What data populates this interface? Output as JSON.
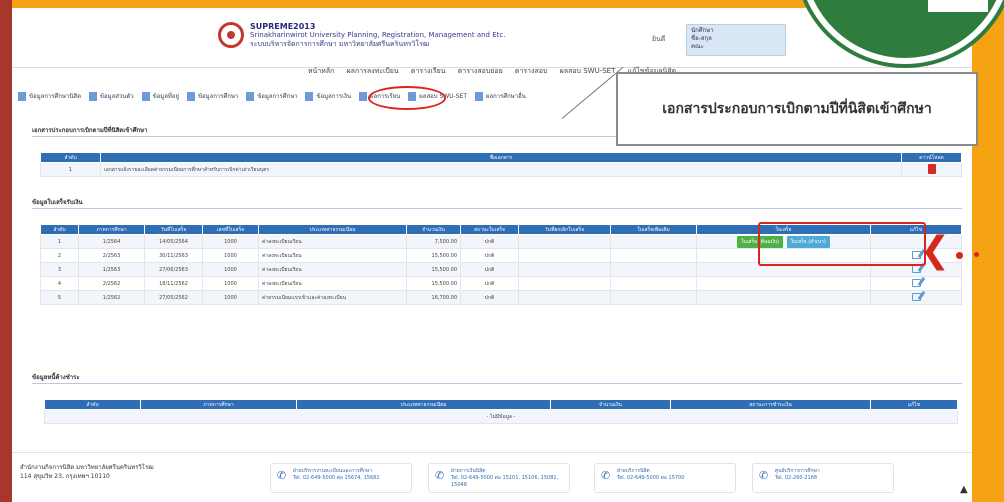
{
  "header": {
    "brand_title": "SUPREME2013",
    "brand_line1": "Srinakharinwirot University Planning, Registration, Management and Etc.",
    "brand_line2": "ระบบบริหารจัดการการศึกษา มหาวิทยาลัยศรีนครินทรวิโรฒ",
    "user_label": "ยินดี",
    "user_lines": [
      "นักศึกษา",
      "ชื่อ-สกุล",
      "คณะ"
    ]
  },
  "menu": [
    "หน้าหลัก",
    "ผลการลงทะเบียน",
    "ตารางเรียน",
    "ตารางสอบย่อย",
    "ตารางสอบ",
    "ผลสอบ SWU-SET",
    "แก้ไขข้อมูลนิสิต"
  ],
  "tabs": [
    "ข้อมูลการศึกษานิสิต",
    "ข้อมูลส่วนตัว",
    "ข้อมูลที่อยู่",
    "ข้อมูลการศึกษา",
    "ข้อมูลการศึกษา",
    "ข้อมูลการเงิน",
    "ผลการเรียน",
    "ผลสอบ SWU-SET",
    "ผลการศึกษาอื่น"
  ],
  "callout": "เอกสารประกอบการเบิกตามปีที่นิสิตเข้าศึกษา",
  "doc_section": {
    "title": "เอกสารประกอบการเบิกตามปีที่นิสิตเข้าศึกษา",
    "columns": [
      "ลำดับ",
      "ชื่อเอกสาร",
      "ดาวน์โหลด"
    ],
    "rows": [
      {
        "no": "1",
        "name": "เอกสารแจ้งรายละเอียดค่าธรรมเนียมการศึกษาสำหรับการเบิกค่าเล่าเรียนบุตร"
      }
    ]
  },
  "payment_section": {
    "title": "ข้อมูลใบเสร็จรับเงิน",
    "columns": [
      "ลำดับ",
      "ภาคการศึกษา",
      "วันที่ใบเสร็จ",
      "เลขที่ใบเสร็จ",
      "ประเภทค่าธรรมเนียม",
      "จำนวนเงิน",
      "สถานะใบเสร็จ",
      "วันที่ยกเลิกใบเสร็จ",
      "ใบเสร็จเพิ่มเติม",
      "ใบเสร็จ",
      "แก้ไข"
    ],
    "button_green": "ใบเสร็จ (ต้นฉบับ)",
    "button_blue": "ใบเสร็จ (สำเนา)",
    "rows": [
      {
        "no": "1",
        "term": "1/2564",
        "date": "14/05/2564",
        "receipt": "1000",
        "type": "ค่าลงทะเบียนเรียน",
        "amount": "7,500.00",
        "status": "ปกติ"
      },
      {
        "no": "2",
        "term": "2/2563",
        "date": "30/11/2563",
        "receipt": "1000",
        "type": "ค่าลงทะเบียนเรียน",
        "amount": "15,500.00",
        "status": "ปกติ"
      },
      {
        "no": "3",
        "term": "1/2563",
        "date": "27/06/2563",
        "receipt": "1000",
        "type": "ค่าลงทะเบียนเรียน",
        "amount": "15,500.00",
        "status": "ปกติ"
      },
      {
        "no": "4",
        "term": "2/2562",
        "date": "18/11/2562",
        "receipt": "1000",
        "type": "ค่าลงทะเบียนเรียน",
        "amount": "15,500.00",
        "status": "ปกติ"
      },
      {
        "no": "5",
        "term": "1/2562",
        "date": "27/05/2562",
        "receipt": "1000",
        "type": "ค่าธรรมเนียมแรกเข้าและค่าลงทะเบียน",
        "amount": "16,700.00",
        "status": "ปกติ"
      }
    ]
  },
  "debt_section": {
    "title": "ข้อมูลหนี้ค้างชำระ",
    "columns": [
      "ลำดับ",
      "ภาคการศึกษา",
      "ประเภทค่าธรรมเนียม",
      "จำนวนเงิน",
      "สถานะการชำระเงิน",
      "แก้ไข"
    ],
    "empty_text": "- ไม่มีข้อมูล -"
  },
  "footer": {
    "line1": "สำนักงานกิจการนิสิต มหาวิทยาลัยศรีนครินทรวิโรฒ",
    "line2": "114 สุขุมวิท 23, กรุงเทพฯ 10110",
    "contacts": [
      {
        "title": "ฝ่ายบริหารงานทะเบียนและการศึกษา",
        "detail": "Tel. 02-649-5000 ต่อ 15674, 15682"
      },
      {
        "title": "ฝ่ายการเงินนิสิต",
        "detail": "Tel. 02-649-5000 ต่อ 15101, 15106, 15081, 15048"
      },
      {
        "title": "ฝ่ายบริการนิสิต",
        "detail": "Tel. 02-649-5000 ต่อ 15700"
      },
      {
        "title": "ศูนย์บริการการศึกษา",
        "detail": "Tel. 02-260-2168"
      }
    ]
  },
  "colors": {
    "accent": "#2f6db5",
    "highlight": "#d9261c",
    "frame": "#f5a312",
    "green_badge": "#2e7d3e"
  }
}
